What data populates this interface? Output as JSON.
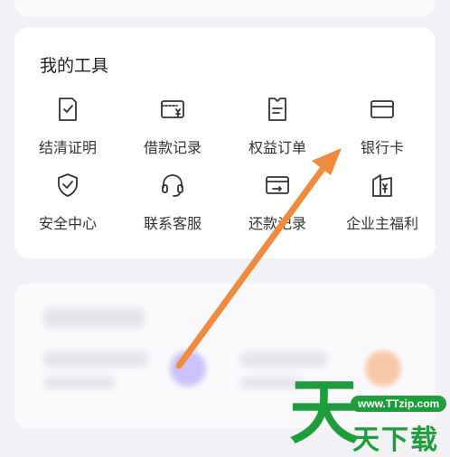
{
  "tools": {
    "title": "我的工具",
    "items": [
      {
        "label": "结清证明",
        "icon": "settlement-proof-icon"
      },
      {
        "label": "借款记录",
        "icon": "loan-record-icon"
      },
      {
        "label": "权益订单",
        "icon": "benefit-order-icon"
      },
      {
        "label": "银行卡",
        "icon": "bank-card-icon"
      },
      {
        "label": "安全中心",
        "icon": "security-shield-icon"
      },
      {
        "label": "联系客服",
        "icon": "headset-icon"
      },
      {
        "label": "还款记录",
        "icon": "repayment-record-icon"
      },
      {
        "label": "企业主福利",
        "icon": "business-welfare-icon"
      }
    ]
  },
  "watermark": {
    "big_char": "天",
    "url": "www.TTzip.com",
    "text": "天下载"
  },
  "colors": {
    "arrow": "#f08a3c",
    "watermark": "#1e9e3a",
    "icon_stroke": "#333333"
  }
}
